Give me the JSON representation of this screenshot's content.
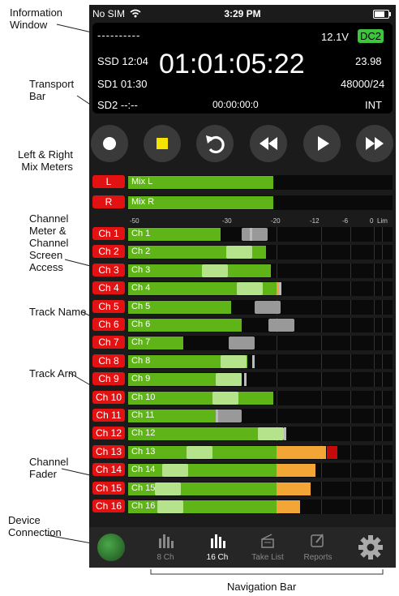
{
  "callouts": {
    "information_window": "Information\nWindow",
    "transport_bar": "Transport\nBar",
    "left_right_mix_meters": "Left & Right\nMix Meters",
    "channel_meter": "Channel\nMeter &\nChannel\nScreen\nAccess",
    "track_name": "Track Name",
    "track_arm": "Track Arm",
    "channel_fader": "Channel\nFader",
    "device_connection": "Device\nConnection",
    "navigation_bar": "Navigation Bar"
  },
  "status_bar": {
    "carrier": "No SIM",
    "time": "3:29 PM"
  },
  "info_window": {
    "dashes": "----------",
    "voltage": "12.1V",
    "power_source": "DC2",
    "ssd": "SSD 12:04",
    "sd1": "SD1 01:30",
    "sd2": "SD2 --:--",
    "timecode": "01:01:05:22",
    "frame_rate": "23.98",
    "sample_rate": "48000/24",
    "sub_timecode": "00:00:00:0",
    "timecode_mode": "INT"
  },
  "transport": {
    "icons": [
      "record-icon",
      "stop-icon",
      "loop-icon",
      "rewind-icon",
      "play-icon",
      "fast-forward-icon"
    ],
    "stop_color": "#f5e300",
    "button_bg": "#3a3a3a"
  },
  "mix_meters": [
    {
      "button": "L",
      "name": "Mix L",
      "level": 0.55
    },
    {
      "button": "R",
      "name": "Mix R",
      "level": 0.55
    }
  ],
  "scale_labels": [
    "-50",
    "-30",
    "-20",
    "-12",
    "-6",
    "0",
    "Lim"
  ],
  "channels": [
    {
      "button": "Ch 1",
      "name": "Ch 1",
      "level": 0.35,
      "peak": 0.46,
      "fader": 0.43,
      "hold": 0,
      "clip": 0
    },
    {
      "button": "Ch 2",
      "name": "Ch 2",
      "level": 0.52,
      "peak": 0,
      "fader": 0.37,
      "hold": 0,
      "clip": 0
    },
    {
      "button": "Ch 3",
      "name": "Ch 3",
      "level": 0.54,
      "peak": 0,
      "fader": 0.28,
      "hold": 0,
      "clip": 0
    },
    {
      "button": "Ch 4",
      "name": "Ch 4",
      "level": 0.56,
      "peak": 0.57,
      "fader": 0.41,
      "hold": 0.02,
      "clip": 0
    },
    {
      "button": "Ch 5",
      "name": "Ch 5",
      "level": 0.39,
      "peak": 0,
      "fader": 0.48,
      "hold": 0,
      "clip": 0
    },
    {
      "button": "Ch 6",
      "name": "Ch 6",
      "level": 0.43,
      "peak": 0,
      "fader": 0.53,
      "hold": 0,
      "clip": 0
    },
    {
      "button": "Ch 7",
      "name": "Ch 7",
      "level": 0.21,
      "peak": 0,
      "fader": 0.38,
      "hold": 0,
      "clip": 0
    },
    {
      "button": "Ch 8",
      "name": "Ch 8",
      "level": 0.45,
      "peak": 0.47,
      "fader": 0.35,
      "hold": 0,
      "clip": 0
    },
    {
      "button": "Ch 9",
      "name": "Ch 9",
      "level": 0.43,
      "peak": 0.44,
      "fader": 0.33,
      "hold": 0,
      "clip": 0
    },
    {
      "button": "Ch 10",
      "name": "Ch 10",
      "level": 0.55,
      "peak": 0,
      "fader": 0.32,
      "hold": 0,
      "clip": 0
    },
    {
      "button": "Ch 11",
      "name": "Ch 11",
      "level": 0.33,
      "peak": 0.33,
      "fader": 0.33,
      "hold": 0,
      "clip": 0
    },
    {
      "button": "Ch 12",
      "name": "Ch 12",
      "level": 0.54,
      "peak": 0.59,
      "fader": 0.49,
      "hold": 0,
      "clip": 0
    },
    {
      "button": "Ch 13",
      "name": "Ch 13",
      "level": 0.56,
      "peak": 0,
      "fader": 0.22,
      "hold": 0.19,
      "clip": 0.04
    },
    {
      "button": "Ch 14",
      "name": "Ch 14",
      "level": 0.56,
      "peak": 0,
      "fader": 0.13,
      "hold": 0.15,
      "clip": 0
    },
    {
      "button": "Ch 15",
      "name": "Ch 15",
      "level": 0.56,
      "peak": 0,
      "fader": 0.1,
      "hold": 0.13,
      "clip": 0
    },
    {
      "button": "Ch 16",
      "name": "Ch 16",
      "level": 0.56,
      "peak": 0,
      "fader": 0.11,
      "hold": 0.09,
      "clip": 0
    }
  ],
  "colors": {
    "arm_red": "#e31212",
    "meter_green": "#5fb517",
    "fader_green": "#b4e38c",
    "peak_grey": "#999999",
    "hold_orange": "#f3a535",
    "clip_red": "#c40a0a"
  },
  "nav": {
    "items": [
      {
        "label": "8 Ch",
        "icon": "meters-8ch-icon"
      },
      {
        "label": "16 Ch",
        "icon": "meters-16ch-icon"
      },
      {
        "label": "Take List",
        "icon": "take-list-icon"
      },
      {
        "label": "Reports",
        "icon": "reports-icon"
      }
    ],
    "active": "16 Ch",
    "device_icon": "device-connection-icon",
    "settings_icon": "gear-icon"
  }
}
